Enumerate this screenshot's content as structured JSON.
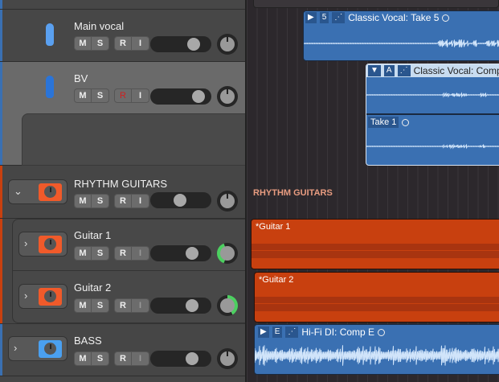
{
  "colors": {
    "vocal": "#4a8ee8",
    "guitar": "#f05a2a",
    "bass": "#4aa0f0",
    "region_blue": "#3a70b2",
    "region_orange": "#c8400f"
  },
  "tracks": [
    {
      "name": "Main vocal",
      "buttons": [
        "M",
        "S",
        "R",
        "I"
      ],
      "icon": "microphone-icon"
    },
    {
      "name": "BV",
      "buttons": [
        "M",
        "S",
        "R",
        "I"
      ],
      "icon": "microphone-icon"
    },
    {
      "name": "RHYTHM GUITARS",
      "buttons": [
        "M",
        "S",
        "R",
        "I"
      ],
      "icon": "amp-icon"
    },
    {
      "name": "Guitar 1",
      "buttons": [
        "M",
        "S",
        "R",
        "I"
      ],
      "icon": "amp-icon"
    },
    {
      "name": "Guitar 2",
      "buttons": [
        "M",
        "S",
        "R",
        "I"
      ],
      "icon": "amp-icon"
    },
    {
      "name": "BASS",
      "buttons": [
        "M",
        "S",
        "R",
        "I"
      ],
      "icon": "amp-icon"
    }
  ],
  "regions": {
    "main_vocal": {
      "take": "5",
      "title": "Classic Vocal: Take 5"
    },
    "bv_comp": {
      "take": "A",
      "title": "Classic Vocal: Comp",
      "subtake": "Take 1"
    },
    "rhythm_label": "RHYTHM GUITARS",
    "guitar1": "*Guitar 1",
    "guitar2": "*Guitar 2",
    "bass": {
      "take": "E",
      "title": "Hi-Fi DI: Comp E"
    }
  }
}
